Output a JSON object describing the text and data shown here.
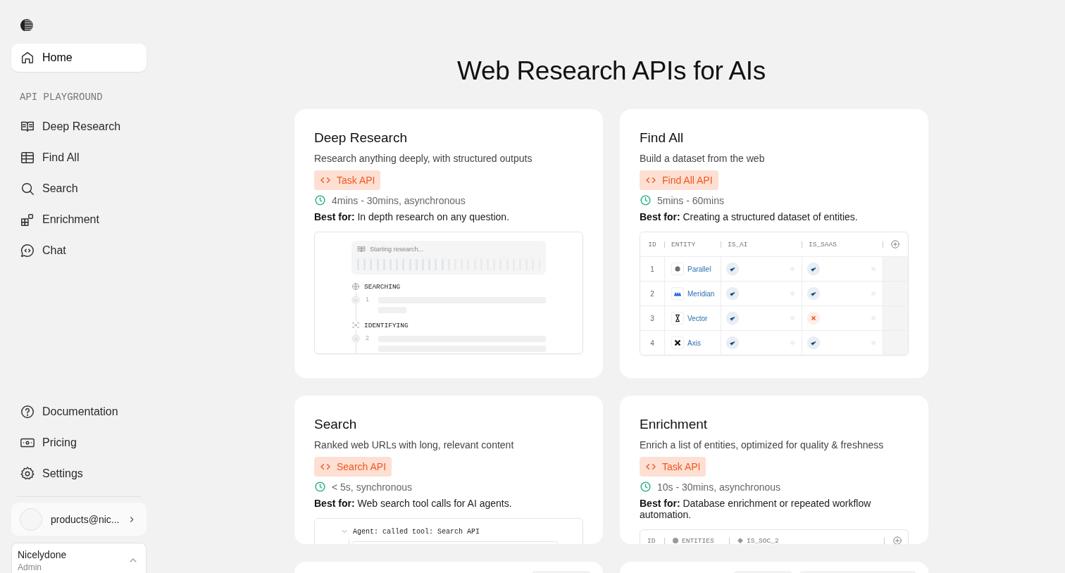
{
  "sidebar": {
    "primary": [
      {
        "label": "Home",
        "selected": true
      }
    ],
    "section_label": "API PLAYGROUND",
    "items": [
      {
        "label": "Deep Research",
        "selected": false
      },
      {
        "label": "Find All",
        "selected": false
      },
      {
        "label": "Search",
        "selected": false
      },
      {
        "label": "Enrichment",
        "selected": false
      },
      {
        "label": "Chat",
        "selected": false
      }
    ],
    "bottom_items": [
      {
        "label": "Documentation",
        "selected": false
      },
      {
        "label": "Pricing",
        "selected": false
      },
      {
        "label": "Settings",
        "selected": false
      }
    ],
    "account": {
      "email": "products@nic..."
    },
    "organization": {
      "name": "Nicelydone",
      "role": "Admin"
    }
  },
  "page_title": "Web Research APIs for AIs",
  "cards": [
    {
      "title": "Deep Research",
      "description": "Research anything deeply, with structured outputs",
      "api": "Task API",
      "timing": "4mins - 30mins, asynchronous",
      "best_for": "**Best for:** In depth research on any question.",
      "preview": {
        "kind": "research",
        "status": "Starting research...",
        "level": 0.5,
        "steps": [
          {
            "label": "SEARCHING",
            "number": "1"
          },
          {
            "label": "IDENTIFYING",
            "number": "2"
          }
        ]
      }
    },
    {
      "title": "Find All",
      "description": "Build a dataset from the web",
      "api": "Find All API",
      "timing": "5mins - 60mins",
      "best_for": "**Best for:** Creating a structured dataset of entities.",
      "preview": {
        "kind": "table",
        "columns": [
          "ID",
          "ENTITY",
          "IS_AI",
          "IS_SAAS"
        ],
        "rows": [
          {
            "id": "1",
            "entity": "Parallel",
            "is_ai": true,
            "is_saas": true
          },
          {
            "id": "2",
            "entity": "Meridian",
            "is_ai": true,
            "is_saas": true
          },
          {
            "id": "3",
            "entity": "Vector",
            "is_ai": true,
            "is_saas": false
          },
          {
            "id": "4",
            "entity": "Axis",
            "is_ai": true,
            "is_saas": true
          }
        ]
      }
    },
    {
      "title": "Search",
      "description": "Ranked web URLs with long, relevant content",
      "api": "Search API",
      "timing": "< 5s, synchronous",
      "best_for": "**Best for:** Web search tool calls for AI agents.",
      "preview": {
        "kind": "agent",
        "line": "Agent: called tool: Search API",
        "expanded": true
      }
    },
    {
      "title": "Enrichment",
      "description": "Enrich a list of entities, optimized for quality & freshness",
      "api": "Task API",
      "timing": "10s - 30mins, asynchronous",
      "best_for": "**Best for:** Database enrichment or repeated workflow automation.",
      "preview": {
        "kind": "columns",
        "columns": [
          "ID",
          "ENTITIES",
          "IS_SOC_2"
        ]
      }
    }
  ],
  "partial_cards": [
    {
      "kind": "single"
    },
    {
      "kind": "double"
    }
  ]
}
